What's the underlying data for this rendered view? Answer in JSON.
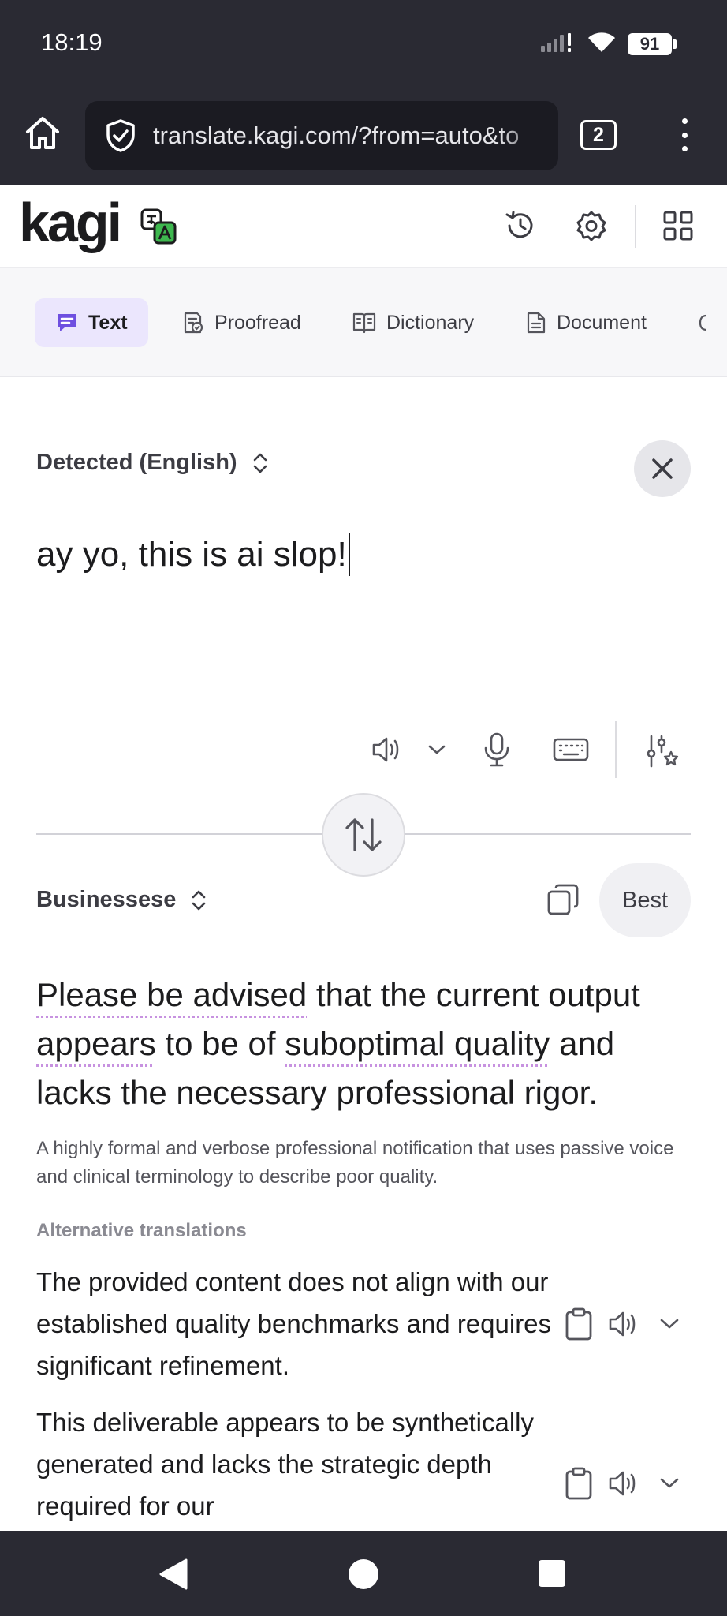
{
  "status_bar": {
    "time": "18:19",
    "battery": "91"
  },
  "browser": {
    "url": "translate.kagi.com/?from=auto&to",
    "tab_count": "2"
  },
  "app": {
    "logo": "kagi"
  },
  "modes": [
    {
      "label": "Text",
      "active": true
    },
    {
      "label": "Proofread"
    },
    {
      "label": "Dictionary"
    },
    {
      "label": "Document"
    }
  ],
  "source": {
    "language": "Detected (English)",
    "text": "ay yo, this is ai slop!"
  },
  "target": {
    "language": "Businessese",
    "quality_button": "Best",
    "translation_parts": [
      "Please be advised",
      " that the current output ",
      "appears",
      " to be of ",
      "suboptimal quality",
      " and lacks the necessary professional rigor."
    ],
    "explanation": "A highly formal and verbose professional notification that uses passive voice and clinical terminology to describe poor quality."
  },
  "alternatives": {
    "title": "Alternative translations",
    "items": [
      "The provided content does not align with our established quality benchmarks and requires significant refinement.",
      "This deliverable appears to be synthetically generated and lacks the strategic depth required for our"
    ]
  },
  "colors": {
    "accent_tab": "#ebe6fd",
    "accent_icon": "#6e4fe0",
    "chrome": "#2a2a33",
    "underline": "#c792e0"
  }
}
